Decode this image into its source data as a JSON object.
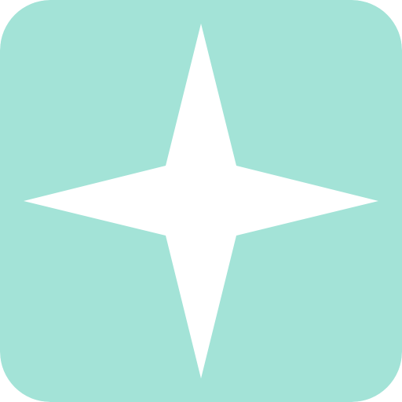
{
  "icon": {
    "name": "four-point-star-icon",
    "background_color": "#a3e3d7",
    "glyph_color": "#ffffff"
  }
}
